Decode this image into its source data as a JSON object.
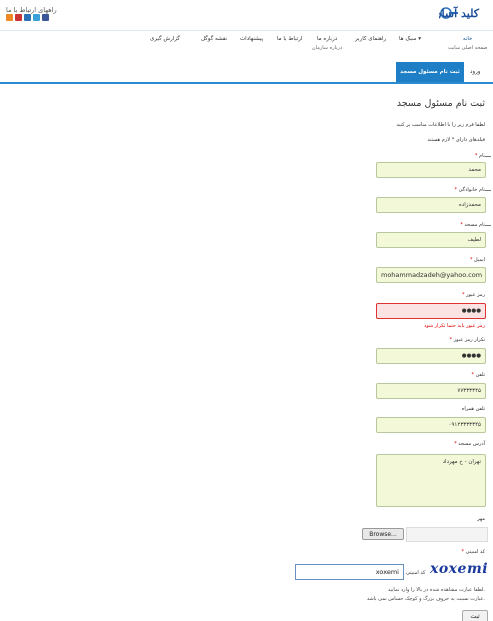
{
  "header": {
    "social_label": "راههای ارتباط با ما",
    "social_icons": [
      {
        "name": "rss-icon",
        "color": "#f08a24"
      },
      {
        "name": "youtube-icon",
        "color": "#cc3333"
      },
      {
        "name": "linkedin-icon",
        "color": "#2a72b5"
      },
      {
        "name": "twitter-icon",
        "color": "#3aa0d8"
      },
      {
        "name": "facebook-icon",
        "color": "#3b5998"
      }
    ],
    "logo_text": "کلید آسان"
  },
  "nav": {
    "items": [
      {
        "label": "خانه",
        "sub": "صفحه اصلی سایت"
      },
      {
        "label": "سبک ها ▾",
        "sub": ""
      },
      {
        "label": "راهنمای کاربر",
        "sub": ""
      },
      {
        "label": "درباره ما",
        "sub": "درباره سازمان"
      },
      {
        "label": "ارتباط با ما",
        "sub": ""
      },
      {
        "label": "پیشنهادات",
        "sub": ""
      },
      {
        "label": "نقشه گوگل",
        "sub": ""
      },
      {
        "label": "گزارش گیری",
        "sub": ""
      }
    ]
  },
  "tabs": {
    "active": "ثبت نام مسئول مسجد",
    "login": "ورود"
  },
  "form": {
    "title": "ثبت نام مسئول مسجد",
    "intro_1": "لطفا فرم زیر را با اطلاعات مناسب پر کنید",
    "intro_2": "فیلدهای دارای * لازم هستند",
    "required_mark": "*",
    "fields": {
      "first_name": {
        "label": "نام",
        "value": "محمد"
      },
      "last_name": {
        "label": "نام خانوادگی",
        "value": "محمدزاده"
      },
      "mosque_name": {
        "label": "نام مسجد",
        "value": "لطیف"
      },
      "email": {
        "label": "ایمیل",
        "value": "mohammadzadeh@yahoo.com"
      },
      "password": {
        "label": "رمز عبور",
        "value": "●●●●",
        "error": "رمز عبور باید حتما تکرار شود"
      },
      "password_confirm": {
        "label": "تکرار رمز عبور",
        "value": "●●●●"
      },
      "phone": {
        "label": "تلفن",
        "value": "۷۷۳۳۳۳۴۵"
      },
      "mobile": {
        "label": "تلفن همراه",
        "value": "۰۹۱۲۳۳۳۳۳۴۵"
      },
      "address": {
        "label": "آدرس مسجد",
        "value": "تهران - خ مهرداد"
      }
    },
    "stamp": {
      "label": "مهر",
      "browse_label": "Browse..."
    },
    "captcha": {
      "label": "کد امنیتی",
      "prefix": "کد امنیتی",
      "value": "xoxemi",
      "image_text": "xoxemi",
      "hint_1": "لطفا عبارت مشاهده شده در بالا را وارد نمایید.",
      "hint_2": "عبارت نسبت به حروف بزرگ و کوچک حساس نمی باشد."
    },
    "submit_label": "ثبت"
  }
}
